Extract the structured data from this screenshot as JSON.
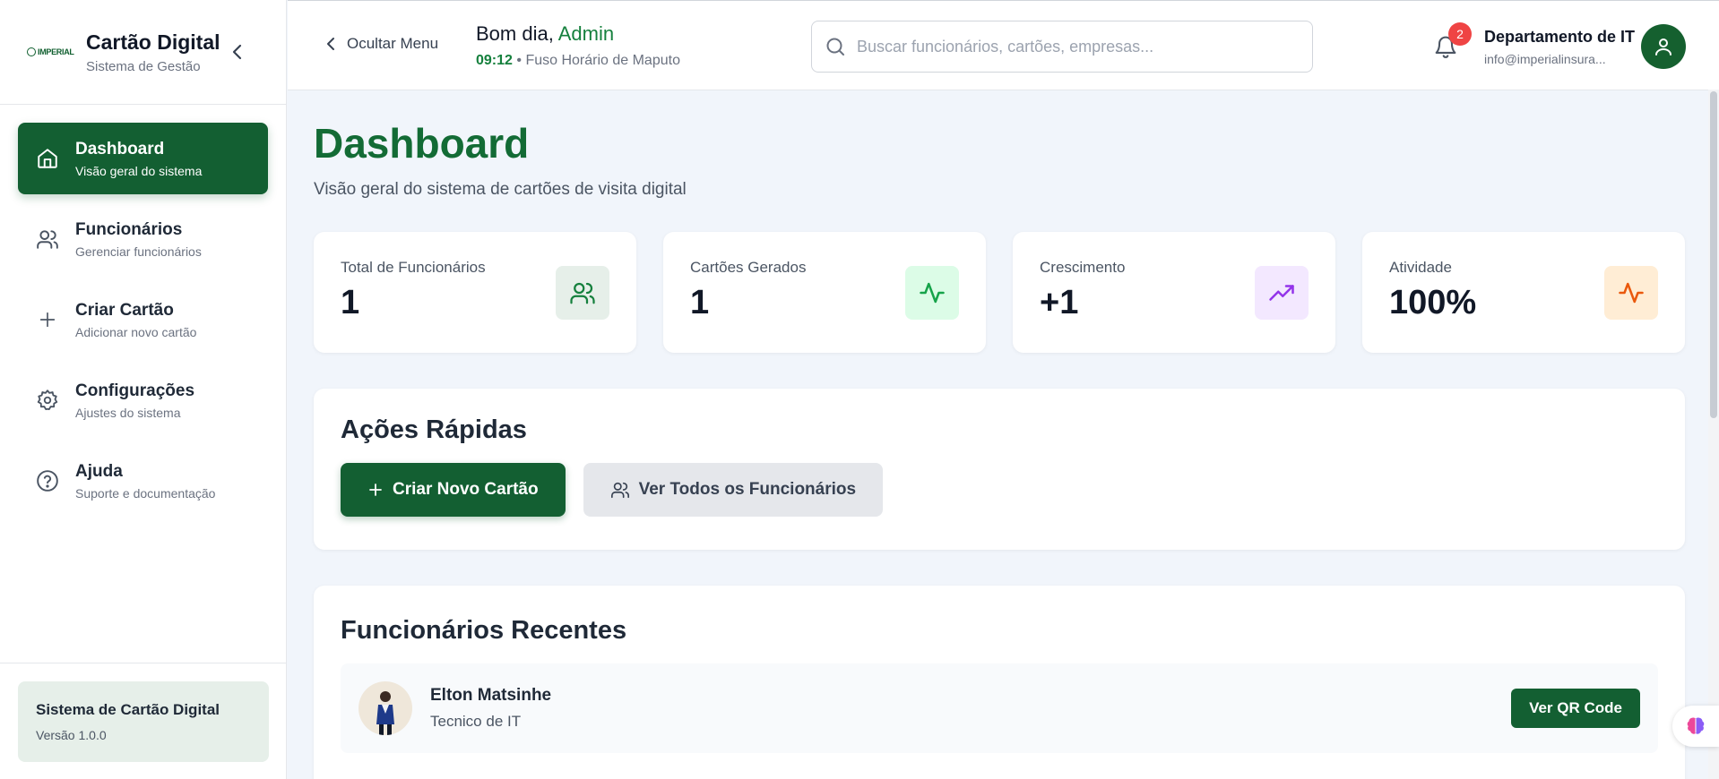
{
  "brand": {
    "logo_text": "IMPERIAL",
    "title": "Cartão Digital",
    "subtitle": "Sistema de Gestão"
  },
  "nav": [
    {
      "label": "Dashboard",
      "desc": "Visão geral do sistema",
      "icon": "home-icon",
      "active": true
    },
    {
      "label": "Funcionários",
      "desc": "Gerenciar funcionários",
      "icon": "users-icon"
    },
    {
      "label": "Criar Cartão",
      "desc": "Adicionar novo cartão",
      "icon": "plus-icon"
    },
    {
      "label": "Configurações",
      "desc": "Ajustes do sistema",
      "icon": "gear-icon"
    },
    {
      "label": "Ajuda",
      "desc": "Suporte e documentação",
      "icon": "help-circle-icon"
    }
  ],
  "footer": {
    "title": "Sistema de Cartão Digital",
    "version": "Versão 1.0.0"
  },
  "header": {
    "hide_menu": "Ocultar Menu",
    "greeting": "Bom dia,",
    "user_role": "Admin",
    "time": "09:12",
    "separator": "•",
    "timezone": "Fuso Horário de Maputo",
    "search_placeholder": "Buscar funcionários, cartões, empresas...",
    "notification_count": "2",
    "user_name": "Departamento de IT",
    "user_email": "info@imperialinsura..."
  },
  "page": {
    "title": "Dashboard",
    "subtitle": "Visão geral do sistema de cartões de visita digital"
  },
  "stats": [
    {
      "label": "Total de Funcionários",
      "value": "1",
      "icon": "users-icon",
      "color": "#15803d",
      "bg": "#e6efe9"
    },
    {
      "label": "Cartões Gerados",
      "value": "1",
      "icon": "activity-icon",
      "color": "#16a34a",
      "bg": "#dcfce7"
    },
    {
      "label": "Crescimento",
      "value": "+1",
      "icon": "trending-up-icon",
      "color": "#9333ea",
      "bg": "#f3e8ff"
    },
    {
      "label": "Atividade",
      "value": "100%",
      "icon": "activity-icon",
      "color": "#ea580c",
      "bg": "#ffedd5"
    }
  ],
  "quick_actions": {
    "title": "Ações Rápidas",
    "primary": "Criar Novo Cartão",
    "secondary": "Ver Todos os Funcionários"
  },
  "recent": {
    "title": "Funcionários Recentes",
    "employees": [
      {
        "name": "Elton Matsinhe",
        "role": "Tecnico de IT",
        "action": "Ver QR Code"
      }
    ]
  },
  "colors": {
    "brand": "#135f32",
    "accent": "#15803d",
    "badge": "#ef4444"
  }
}
